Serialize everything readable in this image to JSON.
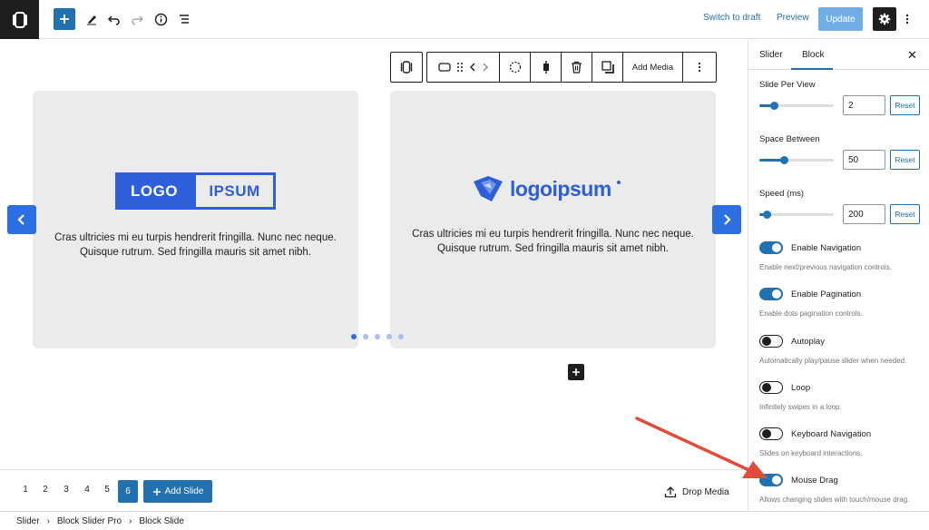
{
  "toolbar": {
    "switch_to_draft": "Switch to draft",
    "preview": "Preview",
    "update": "Update"
  },
  "block_toolbar": {
    "add_media": "Add Media"
  },
  "slides": [
    {
      "logo_left": "LOGO",
      "logo_right": "IPSUM",
      "text_line1": "Cras ultricies mi eu turpis hendrerit fringilla. Nunc nec neque.",
      "text_line2": "Quisque rutrum. Sed fringilla mauris sit amet nibh."
    },
    {
      "logo": "logoipsum",
      "text_line1": "Cras ultricies mi eu turpis hendrerit fringilla. Nunc nec neque.",
      "text_line2": "Quisque rutrum. Sed fringilla mauris sit amet nibh."
    }
  ],
  "pagination": {
    "pages": [
      "1",
      "2",
      "3",
      "4",
      "5",
      "6"
    ],
    "active_page": "6",
    "add_slide": "Add Slide",
    "drop_media": "Drop Media"
  },
  "breadcrumb": [
    "Slider",
    "Block Slider Pro",
    "Block Slide"
  ],
  "sidebar": {
    "tabs": [
      "Slider",
      "Block"
    ],
    "active_tab": "Block",
    "slide_per_view": {
      "label": "Slide Per View",
      "value": "2",
      "reset": "Reset",
      "level": 0.2
    },
    "space_between": {
      "label": "Space Between",
      "value": "50",
      "reset": "Reset",
      "level": 0.33
    },
    "speed": {
      "label": "Speed (ms)",
      "value": "200",
      "reset": "Reset",
      "level": 0.1
    },
    "toggles": [
      {
        "label": "Enable Navigation",
        "help": "Enable next/previous navigation controls.",
        "on": true
      },
      {
        "label": "Enable Pagination",
        "help": "Enable dots pagination controls.",
        "on": true
      },
      {
        "label": "Autoplay",
        "help": "Automatically play/pause slider when needed.",
        "on": false
      },
      {
        "label": "Loop",
        "help": "Infinitely swipes in a loop.",
        "on": false
      },
      {
        "label": "Keyboard Navigation",
        "help": "Slides on keyboard interactions.",
        "on": false
      },
      {
        "label": "Mouse Drag",
        "help": "Allows changing slides with touch/mouse drag.",
        "on": true
      }
    ]
  },
  "colors": {
    "accent": "#2271b1",
    "nav_arrow": "#2c6fe0",
    "annotation": "#e04b3c"
  }
}
